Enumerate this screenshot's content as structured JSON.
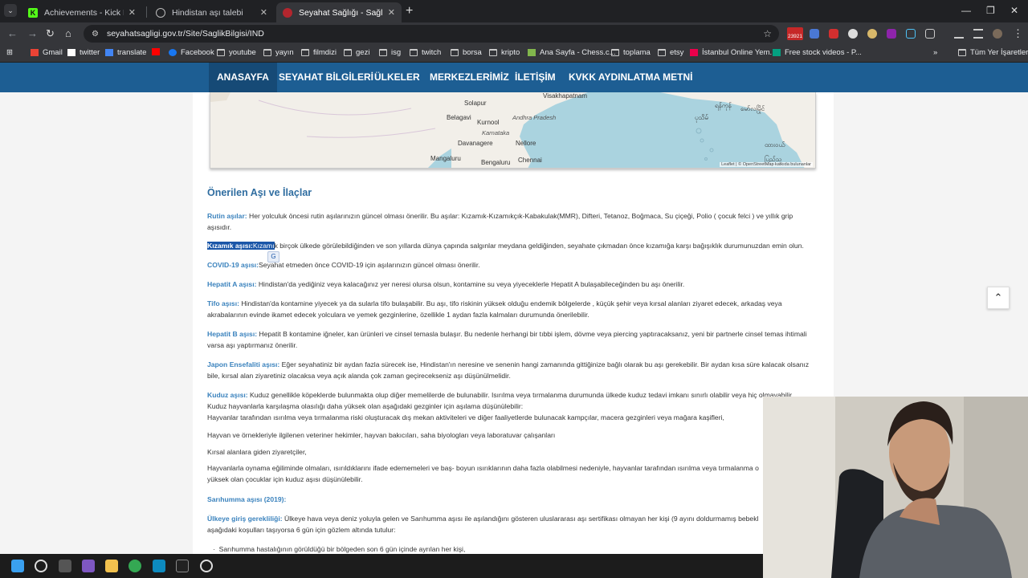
{
  "browser": {
    "tabs": [
      {
        "title": "Achievements - Kick Dashboard",
        "active": false
      },
      {
        "title": "Hindistan aşı talebi",
        "active": false
      },
      {
        "title": "Seyahat Sağlığı - Sağlık Bilgisi",
        "active": true
      }
    ],
    "url": "seyahatsagligi.gov.tr/Site/SaglikBilgisi/IND",
    "extension_badge": "23921",
    "bookmarks": [
      {
        "label": "Gmail",
        "icon": "gmail-icon"
      },
      {
        "label": "twitter",
        "icon": "x-icon"
      },
      {
        "label": "translate",
        "icon": "translate-icon"
      },
      {
        "label": "",
        "icon": "youtube-icon"
      },
      {
        "label": "Facebook",
        "icon": "facebook-icon"
      },
      {
        "label": "youtube",
        "icon": "folder-icon"
      },
      {
        "label": "yayın",
        "icon": "folder-icon"
      },
      {
        "label": "filmdizi",
        "icon": "folder-icon"
      },
      {
        "label": "gezi",
        "icon": "folder-icon"
      },
      {
        "label": "isg",
        "icon": "folder-icon"
      },
      {
        "label": "twitch",
        "icon": "folder-icon"
      },
      {
        "label": "borsa",
        "icon": "folder-icon"
      },
      {
        "label": "kripto",
        "icon": "folder-icon"
      },
      {
        "label": "Ana Sayfa - Chess.c...",
        "icon": "chess-icon"
      },
      {
        "label": "toplama",
        "icon": "folder-icon"
      },
      {
        "label": "etsy",
        "icon": "folder-icon"
      },
      {
        "label": "İstanbul Online Yem...",
        "icon": "yemeksepeti-icon"
      },
      {
        "label": "Free stock videos - P...",
        "icon": "pexels-icon"
      }
    ],
    "all_bookmarks": "Tüm Yer İşaretleri"
  },
  "site_nav": [
    "ANASAYFA",
    "SEYAHAT BİLGİLERİ",
    "ÜLKELER",
    "MERKEZLERİMİZ",
    "İLETİŞİM",
    "KVKK AYDINLATMA METNİ"
  ],
  "map": {
    "labels": [
      "Visakhapatnam",
      "Solapur",
      "Kurnool",
      "Andhra Pradesh",
      "Belagavi",
      "Karnataka",
      "Davanagere",
      "Nellore",
      "Mangaluru",
      "Bengaluru",
      "Chennai",
      "ရန်ကုန်",
      "ပုသိမ်",
      "မော်လမြိုင်",
      "ထားဝယ်",
      "ပြည်သူ"
    ],
    "attribution": "Leaflet | © OpenStreetMap katkıda bulunanlar"
  },
  "content": {
    "heading": "Önerilen Aşı ve İlaçlar",
    "rutin": {
      "key": "Rutin aşılar:",
      "text": " Her yolculuk öncesi rutin aşılarınızın güncel olması önerilir. Bu aşılar: Kızamık-Kızamıkçık-Kabakulak(MMR), Difteri, Tetanoz, Boğmaca, Su çiçeği, Polio ( çocuk felci ) ve yıllık grip aşısıdır."
    },
    "kizamik": {
      "key": "Kızamık aşısı:",
      "key2": "Kızamı",
      "text": "k birçok ülkede görülebildiğinden  ve son yıllarda dünya çapında salgınlar meydana geldiğinden, seyahate çıkmadan önce kızamığa karşı bağışıklık durumunuzdan emin olun."
    },
    "covid": {
      "key": "COVID-19 aşısı:",
      "text": "Seyahat etmeden önce COVID-19 için aşılarınızın güncel olması önerilir."
    },
    "hepa": {
      "key": "Hepatit A aşısı:",
      "text": " Hindistan'da yediğiniz veya kalacağınız yer neresi olursa olsun, kontamine su veya yiyeceklerle Hepatit A bulaşabileceğinden bu aşı önerilir."
    },
    "tifo": {
      "key": "Tifo aşısı:",
      "text": " Hindistan'da kontamine yiyecek ya da sularla tifo bulaşabilir. Bu aşı,  tifo riskinin  yüksek olduğu endemik bölgelerde , küçük şehir veya kırsal alanları ziyaret edecek, arkadaş veya akrabalarının evinde ikamet edecek yolculara ve yemek gezginlerine, özellikle 1 aydan fazla kalmaları durumunda önerilebilir."
    },
    "hepb": {
      "key": "Hepatit B aşısı:",
      "text": " Hepatit B kontamine iğneler, kan ürünleri ve cinsel temasla bulaşır. Bu nedenle herhangi bir tıbbi işlem, dövme veya piercing yaptıracaksanız, yeni bir partnerle cinsel temas ihtimali varsa aşı yaptırmanız önerilir."
    },
    "japon": {
      "key": "Japon Ensefaliti aşısı:",
      "text": " Eğer seyahatiniz bir aydan fazla sürecek ise, Hindistan'ın neresine ve senenin hangi zamanında gittiğinize bağlı olarak bu aşı gerekebilir. Bir aydan kısa süre kalacak olsanız bile, kırsal alan ziyaretiniz olacaksa veya açık alanda çok zaman geçirecekseniz aşı düşünülmelidir."
    },
    "kuduz": {
      "key": "Kuduz aşısı:",
      "text": " Kuduz genellikle köpeklerde bulunmakta olup diğer memelilerde de bulunabilir. Isırılma veya tırmalanma durumunda ülkede kuduz tedavi imkanı sınırlı olabilir veya hiç olmayabilir.",
      "line2": "Kuduz hayvanlarla karşılaşma olasılığı daha yüksek olan aşağıdaki gezginler için aşılama düşünülebilir:",
      "line3": "Hayvanlar tarafından ısırılma veya tırmalanma riski oluşturacak dış mekan aktiviteleri ve diğer faaliyetlerde bulunacak kampçılar, macera gezginleri veya mağara kaşifleri,"
    },
    "hayvan": "Hayvan ve örnekleriyle ilgilenen veteriner hekimler, hayvan bakıcıları, saha biyologları veya laboratuvar çalışanları",
    "kirsal": "Kırsal alanlara giden ziyaretçiler,",
    "cocuk": "Hayvanlarla oynama eğiliminde olmaları, ısırıldıklarını ifade edememeleri ve baş- boyun ısırıklarının daha fazla olabilmesi nedeniyle, hayvanlar tarafından ısırılma veya tırmalanma o yüksek olan çocuklar için kuduz aşısı düşünülebilir.",
    "sari_heading": "Sarıhumma aşısı (2019):",
    "giris": {
      "key": "Ülkeye giriş gerekliliği:",
      "text": " Ülkeye hava veya deniz yoluyla gelen ve Sarıhumma aşısı ile aşılandığını gösteren uluslararası aşı sertifikası olmayan her kişi (9 ayını doldurmamış bebekl aşağıdaki koşulları taşıyorsa 6 gün için gözlem altında tutulur:"
    },
    "bullet1": "Sarıhumma hastalığının görüldüğü bir bölgeden son 6 gün içinde ayrılan her kişi,"
  },
  "colors": {
    "nav_bg": "#1d5e93",
    "nav_active": "#164a76",
    "key_text": "#3a82bd",
    "heading": "#2f6da0",
    "selection": "#1a56a8"
  }
}
